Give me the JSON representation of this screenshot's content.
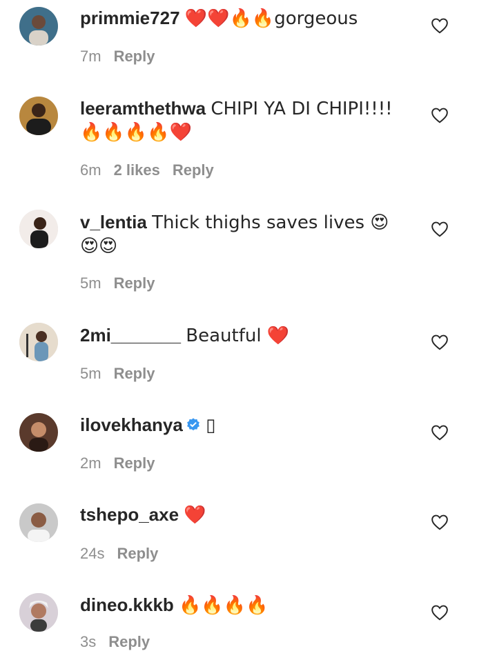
{
  "comments": [
    {
      "username": "primmie727",
      "text": "❤️❤️🔥🔥gorgeous",
      "time": "7m",
      "likes": "",
      "reply": "Reply",
      "verified": false
    },
    {
      "username": "leeramthethwa",
      "text": "CHIPI YA DI CHIPI!!!! 🔥🔥🔥🔥❤️",
      "time": "6m",
      "likes": "2 likes",
      "reply": "Reply",
      "verified": false
    },
    {
      "username": "v_lentia",
      "text": "Thick thighs saves lives 😍😍😍",
      "time": "5m",
      "likes": "",
      "reply": "Reply",
      "verified": false
    },
    {
      "username": "2mi_______",
      "text": "Beautful ❤️",
      "time": "5m",
      "likes": "",
      "reply": "Reply",
      "verified": false
    },
    {
      "username": "ilovekhanya",
      "text": "▯",
      "time": "2m",
      "likes": "",
      "reply": "Reply",
      "verified": true
    },
    {
      "username": "tshepo_axe",
      "text": "❤️",
      "time": "24s",
      "likes": "",
      "reply": "Reply",
      "verified": false
    },
    {
      "username": "dineo.kkkb",
      "text": "🔥🔥🔥🔥",
      "time": "3s",
      "likes": "",
      "reply": "Reply",
      "verified": false
    }
  ],
  "icons": {
    "like": "heart-outline-icon",
    "verified": "verified-badge-icon"
  },
  "colors": {
    "text": "#262626",
    "meta": "#8e8e8e",
    "verified": "#3897f0"
  }
}
